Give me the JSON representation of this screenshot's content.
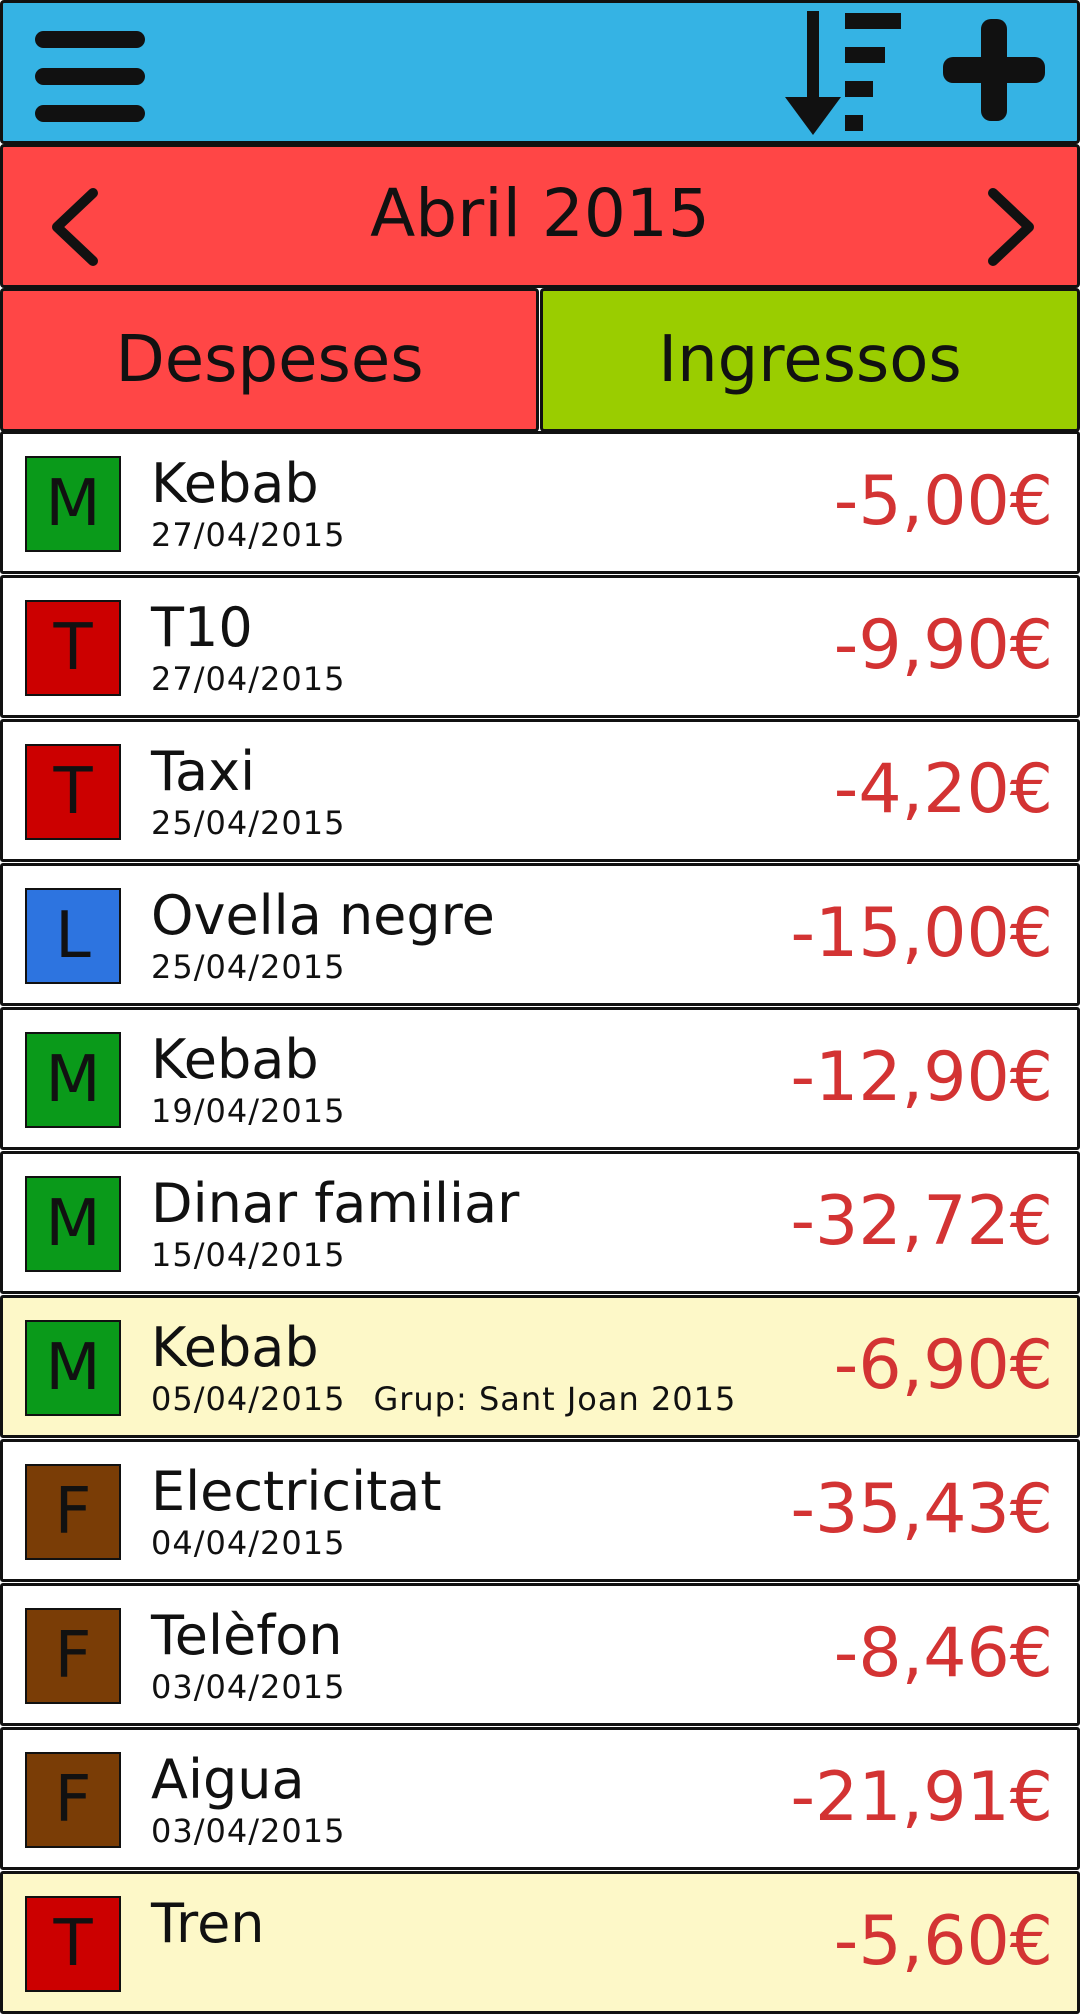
{
  "header": {
    "menu_icon": "hamburger-menu-icon",
    "sort_icon": "sort-descending-icon",
    "add_icon": "plus-icon",
    "color": "#35b3e4"
  },
  "month_nav": {
    "title": "Abril 2015",
    "prev_icon": "chevron-left-icon",
    "next_icon": "chevron-right-icon",
    "color": "#ff4646"
  },
  "tabs": [
    {
      "label": "Despeses",
      "color": "#ff4646"
    },
    {
      "label": "Ingressos",
      "color": "#9acd00"
    }
  ],
  "categories": {
    "M": "#0a9a1a",
    "T": "#cc0000",
    "L": "#2d74e0",
    "F": "#7a3d06"
  },
  "transactions": [
    {
      "cat": "M",
      "name": "Kebab",
      "date": "27/04/2015",
      "group": "",
      "amount": "-5,00€"
    },
    {
      "cat": "T",
      "name": "T10",
      "date": "27/04/2015",
      "group": "",
      "amount": "-9,90€"
    },
    {
      "cat": "T",
      "name": "Taxi",
      "date": "25/04/2015",
      "group": "",
      "amount": "-4,20€"
    },
    {
      "cat": "L",
      "name": "Ovella negre",
      "date": "25/04/2015",
      "group": "",
      "amount": "-15,00€"
    },
    {
      "cat": "M",
      "name": "Kebab",
      "date": "19/04/2015",
      "group": "",
      "amount": "-12,90€"
    },
    {
      "cat": "M",
      "name": "Dinar familiar",
      "date": "15/04/2015",
      "group": "",
      "amount": "-32,72€"
    },
    {
      "cat": "M",
      "name": "Kebab",
      "date": "05/04/2015",
      "group": "Grup: Sant Joan 2015",
      "amount": "-6,90€"
    },
    {
      "cat": "F",
      "name": "Electricitat",
      "date": "04/04/2015",
      "group": "",
      "amount": "-35,43€"
    },
    {
      "cat": "F",
      "name": "Telèfon",
      "date": "03/04/2015",
      "group": "",
      "amount": "-8,46€"
    },
    {
      "cat": "F",
      "name": "Aigua",
      "date": "03/04/2015",
      "group": "",
      "amount": "-21,91€"
    },
    {
      "cat": "T",
      "name": "Tren",
      "date": "",
      "group": "",
      "amount": "-5,60€"
    }
  ],
  "amount_color": "#d33333",
  "group_row_color": "#fdf8c8"
}
